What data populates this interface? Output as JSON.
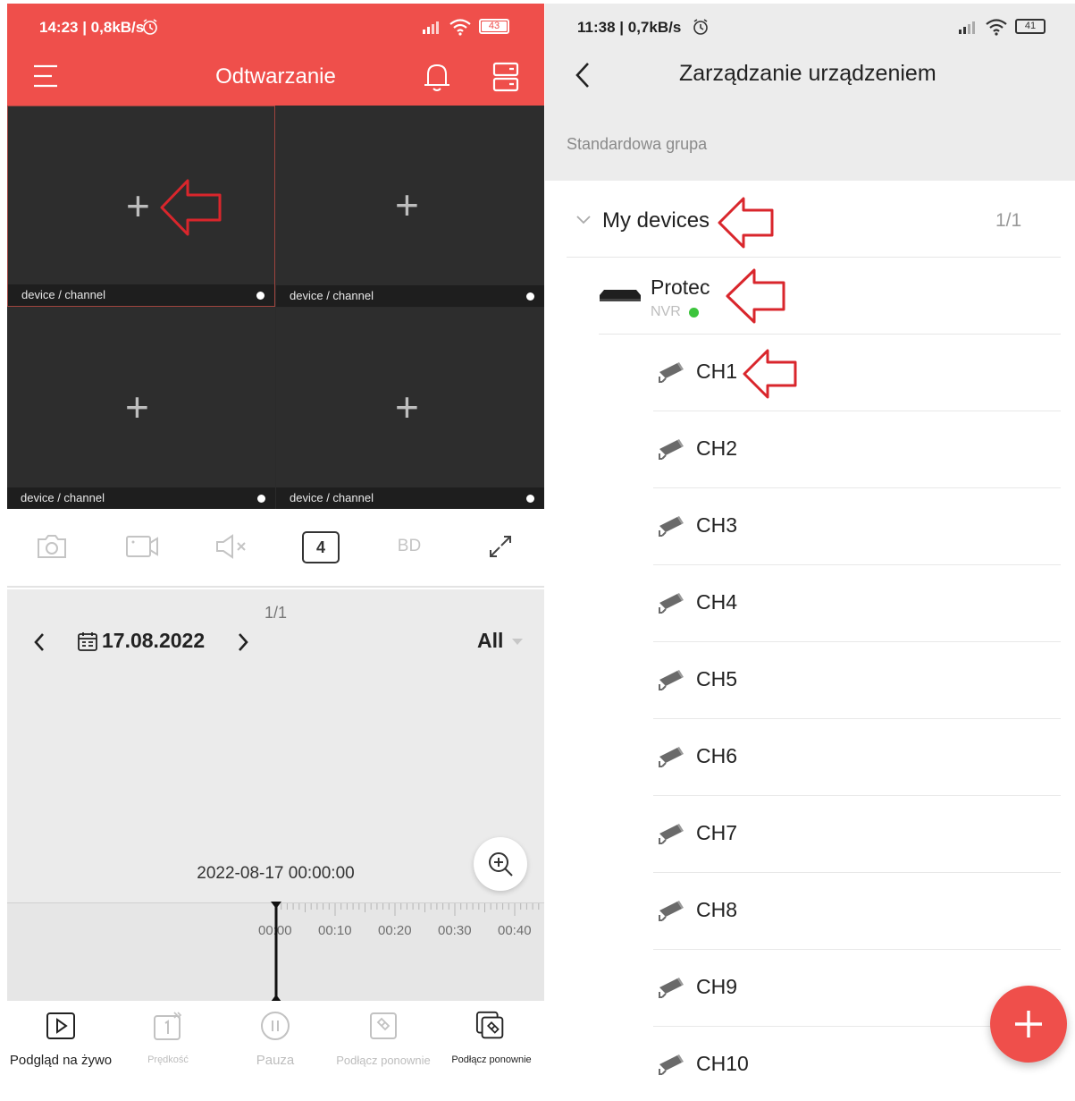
{
  "left": {
    "status": {
      "time": "14:23 | 0,8kB/s",
      "battery": "43"
    },
    "header": {
      "title": "Odtwarzanie"
    },
    "grid": {
      "cells": [
        {
          "label": "device / channel"
        },
        {
          "label": "device / channel"
        },
        {
          "label": "device / channel"
        },
        {
          "label": "device / channel"
        }
      ]
    },
    "toolbar": {
      "split_count": "4",
      "stream_label": "BD"
    },
    "playback": {
      "page_indicator": "1/1",
      "date": "17.08.2022",
      "filter": "All",
      "timestamp": "2022-08-17 00:00:00",
      "timeline_ticks": [
        "00:00",
        "00:10",
        "00:20",
        "00:30",
        "00:40"
      ]
    },
    "bottom_nav": [
      {
        "label": "Podgląd na żywo",
        "icon": "play-square-icon",
        "active": true
      },
      {
        "label": "Prędkość",
        "icon": "speed-icon",
        "active": false
      },
      {
        "label": "Pauza",
        "icon": "pause-icon",
        "active": false
      },
      {
        "label": "Podłącz ponownie",
        "icon": "link-icon",
        "active": false
      },
      {
        "label": "Podłącz ponownie",
        "icon": "reconnect-icon",
        "active": true
      }
    ]
  },
  "right": {
    "status": {
      "time": "11:38 | 0,7kB/s",
      "battery": "41"
    },
    "header": {
      "title": "Zarządzanie urządzeniem"
    },
    "group_label": "Standardowa grupa",
    "tree": {
      "folder": {
        "name": "My devices",
        "count": "1/1"
      },
      "device": {
        "name": "Protec",
        "type": "NVR",
        "online": true
      },
      "channels": [
        "CH1",
        "CH2",
        "CH3",
        "CH4",
        "CH5",
        "CH6",
        "CH7",
        "CH8",
        "CH9",
        "CH10"
      ]
    }
  },
  "colors": {
    "accent": "#ef4f4b",
    "annotation_arrow": "#d9262c",
    "online": "#3cc43c"
  }
}
